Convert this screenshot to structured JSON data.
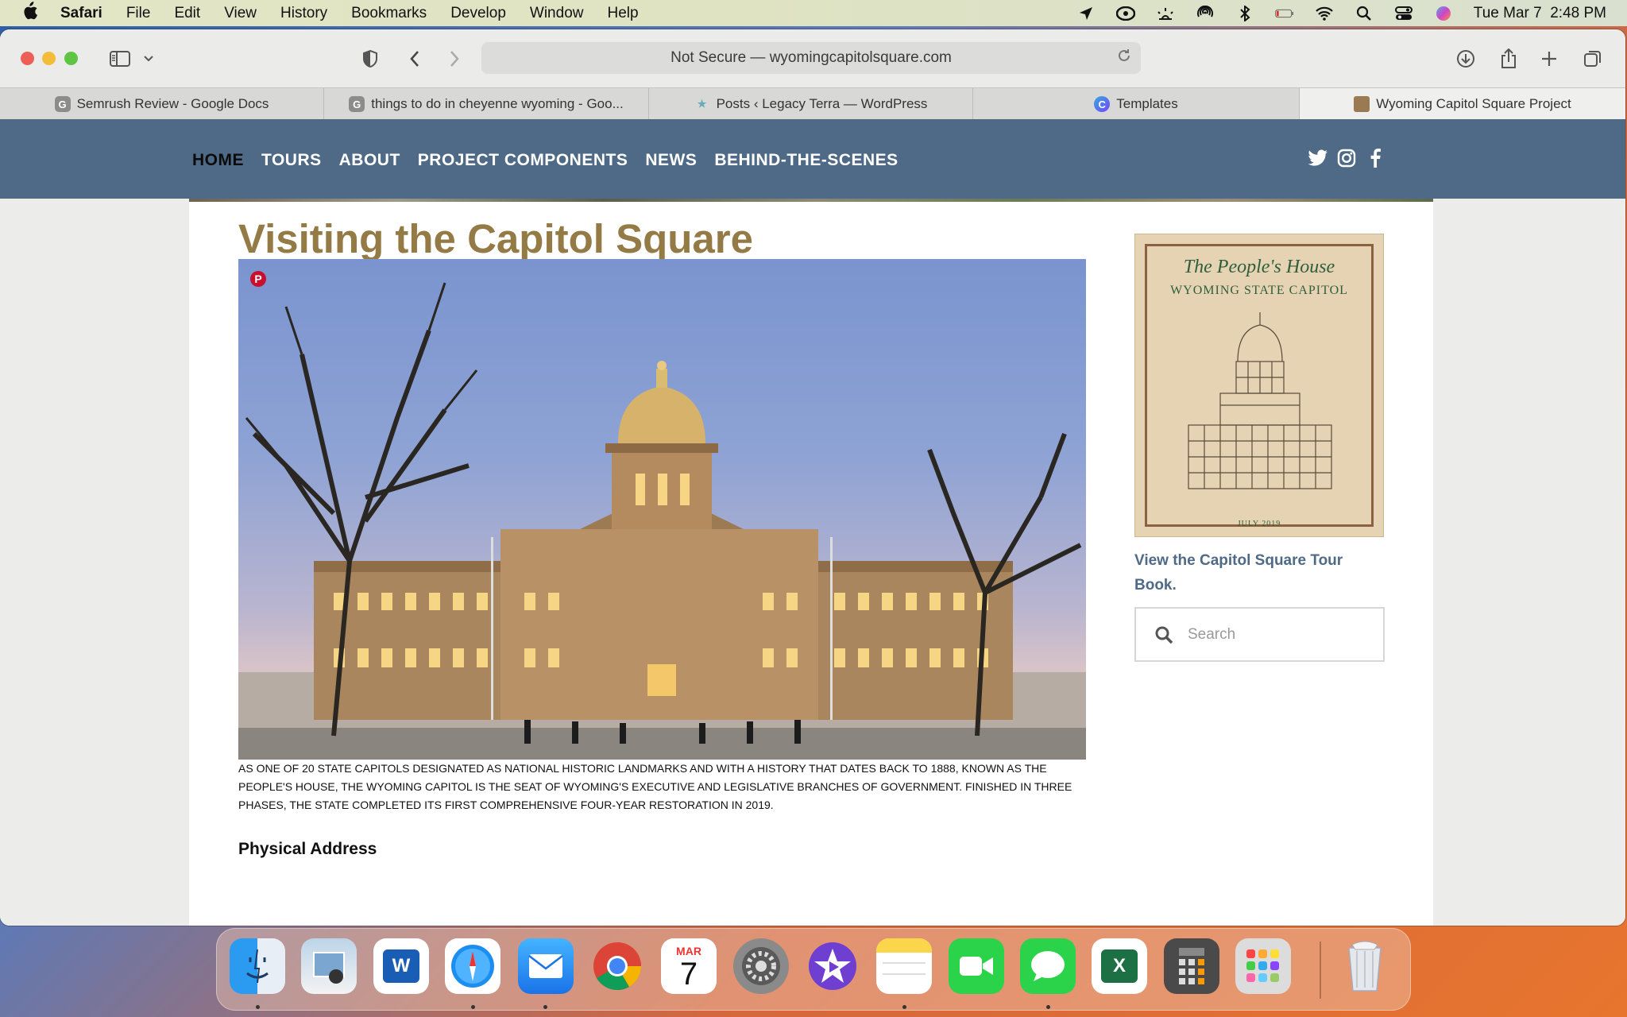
{
  "menubar": {
    "app_name": "Safari",
    "items": [
      "File",
      "Edit",
      "View",
      "History",
      "Bookmarks",
      "Develop",
      "Window",
      "Help"
    ],
    "clock": "Tue Mar 7  2:48 PM"
  },
  "browser": {
    "url_text": "Not Secure — wyomingcapitolsquare.com",
    "tabs": [
      {
        "title": "Semrush Review - Google Docs",
        "icon": "google-docs-icon"
      },
      {
        "title": "things to do in cheyenne wyoming - Goo...",
        "icon": "google-docs-icon"
      },
      {
        "title": "Posts ‹ Legacy Terra — WordPress",
        "icon": "wordpress-icon"
      },
      {
        "title": "Templates",
        "icon": "canva-icon"
      },
      {
        "title": "Wyoming Capitol Square Project",
        "icon": "site-icon",
        "active": true
      }
    ]
  },
  "site": {
    "nav": [
      "HOME",
      "TOURS",
      "ABOUT",
      "PROJECT COMPONENTS",
      "NEWS",
      "BEHIND-THE-SCENES"
    ],
    "social": [
      "twitter-icon",
      "instagram-icon",
      "facebook-icon"
    ],
    "page_title": "Visiting the Capitol Square",
    "description": "As one of 20 state capitols designated as National Historic Landmarks and with a history that dates back to 1888, known as the People's House, the Wyoming Capitol is the seat of Wyoming's executive and legislative branches of government. Finished in three phases, the state completed its first comprehensive four-year restoration in 2019.",
    "section_heading": "Physical Address",
    "sidebar": {
      "book_line1": "The People's House",
      "book_line2": "WYOMING STATE CAPITOL",
      "book_date": "JULY 2019",
      "book_link": "View the Capitol Square Tour Book.",
      "search_placeholder": "Search"
    }
  },
  "dock": {
    "calendar_month": "MAR",
    "calendar_day": "7",
    "apps": [
      "finder",
      "preview",
      "word",
      "safari",
      "mail",
      "chrome",
      "calendar",
      "system-settings",
      "imovie",
      "notes",
      "facetime",
      "messages",
      "excel",
      "calculator",
      "launchpad",
      "trash"
    ]
  }
}
